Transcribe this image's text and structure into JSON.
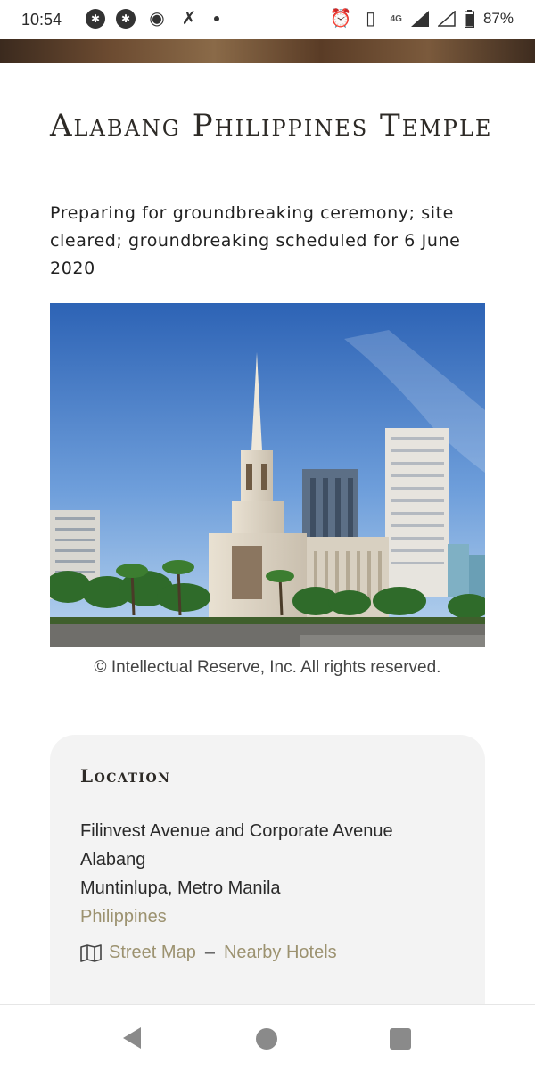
{
  "status_bar": {
    "time": "10:54",
    "network": "4G",
    "battery": "87%"
  },
  "page": {
    "title": "Alabang Philippines Temple",
    "subtitle": "Preparing for groundbreaking ceremony; site cleared; groundbreaking scheduled for 6 June 2020",
    "image_credit": "© Intellectual Reserve, Inc. All rights reserved."
  },
  "location": {
    "heading": "Location",
    "address_lines": [
      "Filinvest Avenue and Corporate Avenue",
      "Alabang",
      "Muntinlupa, Metro Manila"
    ],
    "country": "Philippines",
    "map_icon": "map-icon",
    "street_map_label": "Street Map",
    "separator": "–",
    "nearby_hotels_label": "Nearby Hotels",
    "link_color": "#9c9270"
  },
  "nav_bar": {
    "back_icon": "back-triangle-icon",
    "home_icon": "home-circle-icon",
    "recents_icon": "recents-square-icon"
  }
}
